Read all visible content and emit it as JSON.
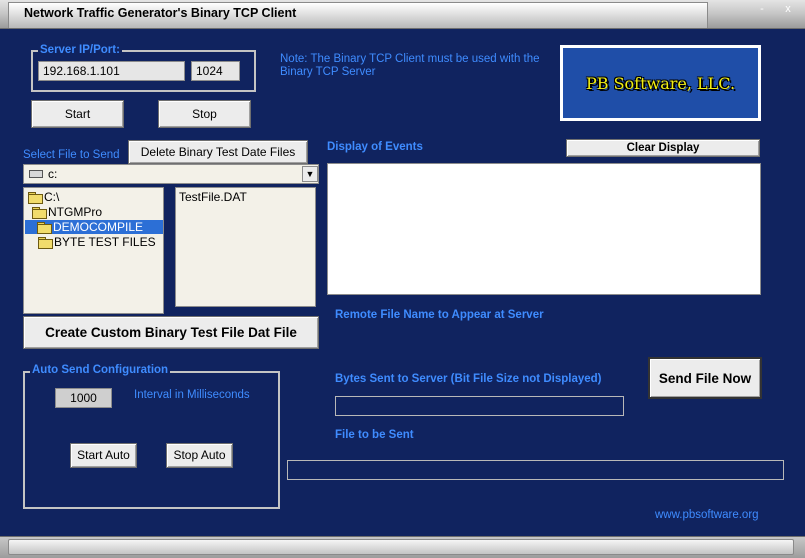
{
  "window": {
    "title": "Network Traffic Generator's Binary TCP Client",
    "minimize_glyph": "-",
    "close_glyph": "x"
  },
  "server": {
    "legend": "Server IP/Port:",
    "ip": "192.168.1.101",
    "port": "1024",
    "start_label": "Start",
    "stop_label": "Stop"
  },
  "note": "Note: The Binary TCP Client must be used with the Binary TCP Server",
  "logo": {
    "text": "PB Software, LLC."
  },
  "file_select": {
    "label": "Select File to Send",
    "delete_label": "Delete Binary Test Date Files",
    "drive": "c:",
    "folders": [
      {
        "name": "C:\\",
        "selected": false
      },
      {
        "name": "NTGMPro",
        "selected": false
      },
      {
        "name": "DEMOCOMPILE",
        "selected": true
      },
      {
        "name": "BYTE TEST FILES",
        "selected": false
      }
    ],
    "files": [
      "TestFile.DAT"
    ],
    "create_label": "Create Custom Binary Test File Dat File"
  },
  "events": {
    "label": "Display of Events",
    "clear_label": "Clear Display",
    "log_text": ""
  },
  "remote": {
    "label": "Remote File Name to Appear at Server",
    "value": ""
  },
  "send": {
    "label": "Send File Now"
  },
  "bytes": {
    "label": "Bytes Sent to Server   (Bit File Size not Displayed)",
    "value": ""
  },
  "file_to_send": {
    "label": "File to be Sent",
    "value": ""
  },
  "auto_send": {
    "legend": "Auto Send Configuration",
    "interval": "1000",
    "interval_label": "Interval in Milliseconds",
    "start_label": "Start Auto",
    "stop_label": "Stop Auto"
  },
  "website": "www.pbsoftware.org",
  "colors": {
    "background": "#10235f",
    "label_blue": "#3f8cff",
    "logo_text": "#f2ef12",
    "selection": "#2c6fd6"
  }
}
